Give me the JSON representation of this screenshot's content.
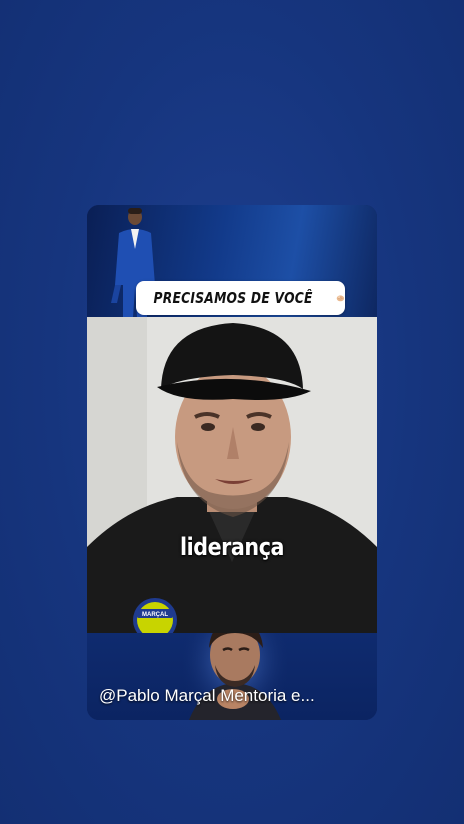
{
  "short": {
    "caption": "PRECISAMOS DE VOCÊ",
    "caption_emoji": "pointing-hand-icon",
    "subtitle": "liderança",
    "channel": "@Pablo Marçal Mentoria e...",
    "badge_text": "MARÇAL"
  },
  "colors": {
    "background": "#16357e",
    "card_banner": "#123a8a",
    "caption_bg": "#ffffff",
    "subtitle": "#ffffff"
  }
}
